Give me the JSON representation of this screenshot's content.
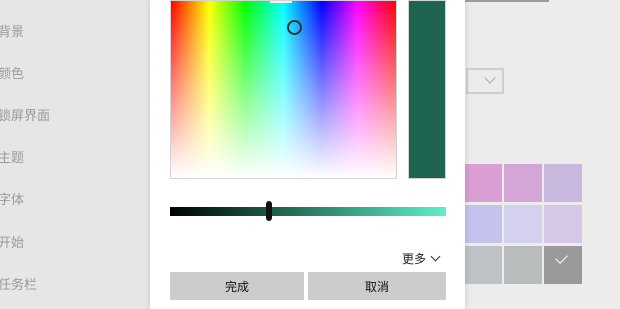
{
  "sidebar": {
    "items": [
      {
        "label": "背景"
      },
      {
        "label": "颜色"
      },
      {
        "label": "锁屏界面"
      },
      {
        "label": "主题"
      },
      {
        "label": "字体"
      },
      {
        "label": "开始"
      },
      {
        "label": "任务栏"
      }
    ]
  },
  "dialog": {
    "selected_color": "#1f6450",
    "brightness_gradient": [
      "#000000",
      "#1f6450",
      "#5ef0c8"
    ],
    "brightness_level": 0.36,
    "more_label": "更多",
    "more_icon": "chevron-down-icon",
    "done_label": "完成",
    "cancel_label": "取消"
  },
  "palette": {
    "swatches": [
      {
        "color": "#da9ed4",
        "selected": false
      },
      {
        "color": "#d4a5d6",
        "selected": false
      },
      {
        "color": "#c9b8de",
        "selected": false
      },
      {
        "color": "#c4c3ee",
        "selected": false
      },
      {
        "color": "#d4d1ee",
        "selected": false
      },
      {
        "color": "#d5c8e6",
        "selected": false
      },
      {
        "color": "#bfc3c6",
        "selected": false
      },
      {
        "color": "#b8bcbd",
        "selected": false
      },
      {
        "color": "#9a9a9a",
        "selected": true
      }
    ]
  }
}
